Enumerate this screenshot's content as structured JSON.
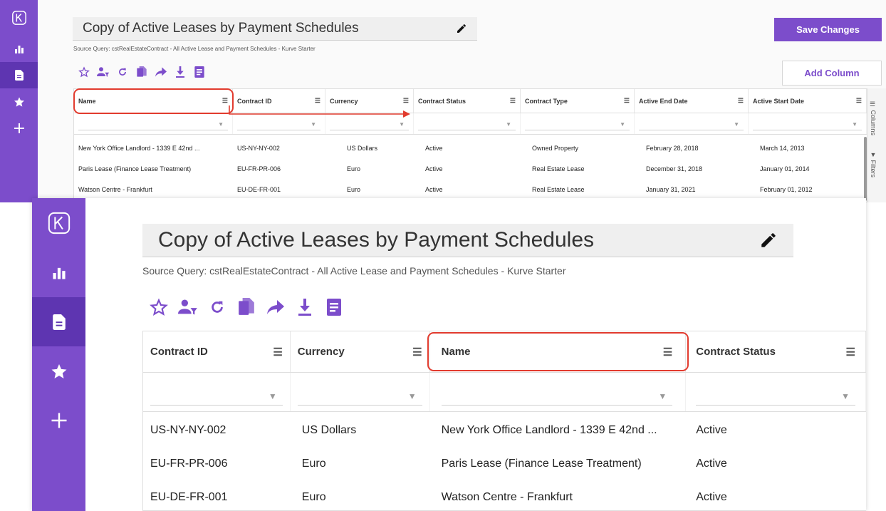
{
  "top_screen": {
    "title": "Copy of Active Leases by Payment Schedules",
    "source_query": "Source Query: cstRealEstateContract - All Active Lease and Payment Schedules - Kurve Starter",
    "save_button": "Save Changes",
    "add_column_button": "Add Column",
    "columns": [
      "Name",
      "Contract ID",
      "Currency",
      "Contract Status",
      "Contract Type",
      "Active End Date",
      "Active Start Date"
    ],
    "rows": [
      [
        "New York Office Landlord - 1339 E 42nd ...",
        "US-NY-NY-002",
        "US Dollars",
        "Active",
        "Owned Property",
        "February 28, 2018",
        "March 14, 2013"
      ],
      [
        "Paris Lease (Finance Lease Treatment)",
        "EU-FR-PR-006",
        "Euro",
        "Active",
        "Real Estate Lease",
        "December 31, 2018",
        "January 01, 2014"
      ],
      [
        "Watson Centre - Frankfurt",
        "EU-DE-FR-001",
        "Euro",
        "Active",
        "Real Estate Lease",
        "January 31, 2021",
        "February 01, 2012"
      ]
    ],
    "side_tabs": {
      "columns": "Columns",
      "filters": "Filters"
    }
  },
  "bottom_screen": {
    "title": "Copy of Active Leases by Payment Schedules",
    "source_query": "Source Query: cstRealEstateContract - All Active Lease and Payment Schedules - Kurve Starter",
    "columns": [
      "Contract ID",
      "Currency",
      "Name",
      "Contract Status"
    ],
    "rows": [
      [
        "US-NY-NY-002",
        "US Dollars",
        "New York Office Landlord - 1339 E 42nd ...",
        "Active"
      ],
      [
        "EU-FR-PR-006",
        "Euro",
        "Paris Lease (Finance Lease Treatment)",
        "Active"
      ],
      [
        "EU-DE-FR-001",
        "Euro",
        "Watson Centre - Frankfurt",
        "Active"
      ]
    ]
  },
  "sidebar_icons": [
    "kurve-logo-icon",
    "bar-chart-icon",
    "document-icon",
    "star-icon",
    "plus-icon"
  ],
  "toolbar_icons": [
    "star-outline-icon",
    "user-filter-icon",
    "refresh-icon",
    "copy-icon",
    "share-icon",
    "download-icon",
    "notes-icon"
  ],
  "colors": {
    "brand_purple": "#7c4dcb",
    "sidebar_active": "#5e35b1",
    "highlight_red": "#e23b2e"
  }
}
